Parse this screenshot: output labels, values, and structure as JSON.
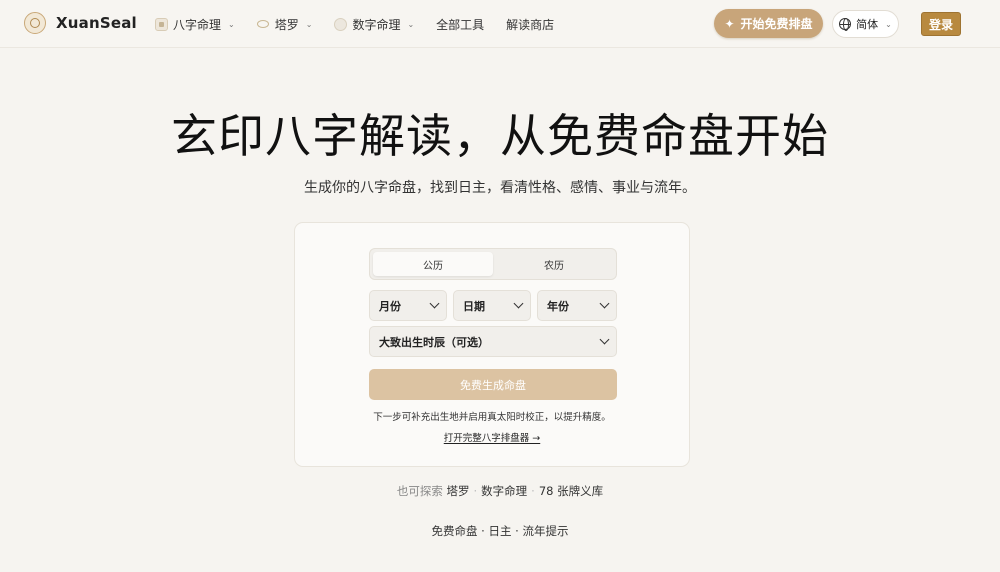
{
  "header": {
    "brand": "XuanSeal",
    "nav": [
      {
        "label": "八字命理",
        "icon": "bazi-icon",
        "has_dropdown": true
      },
      {
        "label": "塔罗",
        "icon": "tarot-icon",
        "has_dropdown": true
      },
      {
        "label": "数字命理",
        "icon": "numerology-icon",
        "has_dropdown": true
      },
      {
        "label": "全部工具",
        "has_dropdown": false
      },
      {
        "label": "解读商店",
        "has_dropdown": false
      }
    ],
    "cta_label": "开始免费排盘",
    "language_label": "简体",
    "login_label": "登录"
  },
  "hero": {
    "title": "玄印八字解读，从免费命盘开始",
    "subtitle": "生成你的八字命盘，找到日主，看清性格、感情、事业与流年。"
  },
  "form": {
    "calendar_tabs": [
      {
        "label": "公历",
        "selected": true
      },
      {
        "label": "农历",
        "selected": false
      }
    ],
    "month_label": "月份",
    "day_label": "日期",
    "year_label": "年份",
    "hour_label": "大致出生时辰（可选）",
    "submit_label": "免费生成命盘",
    "hint": "下一步可补充出生地并启用真太阳时校正，以提升精度。",
    "full_link": "打开完整八字排盘器 →"
  },
  "explore": {
    "prefix": "也可探索",
    "links": [
      "塔罗",
      "数字命理",
      "78 张牌义库"
    ]
  },
  "tagline": "免费命盘 · 日主 · 流年提示",
  "colors": {
    "background": "#f6f4f0",
    "accent": "#c8a57a",
    "login": "#b8893f",
    "submit_disabled": "#dcc3a2"
  }
}
